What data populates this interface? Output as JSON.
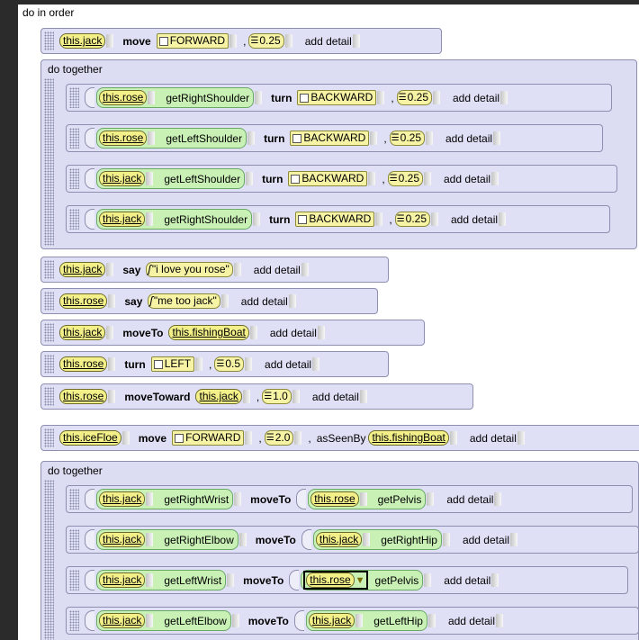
{
  "outer": {
    "label": "do in order"
  },
  "common": {
    "add_detail": "add detail",
    "comma": ","
  },
  "lines": {
    "jack_move": {
      "obj": "this.jack",
      "verb": "move",
      "dir": "FORWARD",
      "amt": "0.25"
    },
    "together1": {
      "label": "do together",
      "rows": [
        {
          "obj": "this.rose",
          "getter": "getRightShoulder",
          "verb": "turn",
          "dir": "BACKWARD",
          "amt": "0.25"
        },
        {
          "obj": "this.rose",
          "getter": "getLeftShoulder",
          "verb": "turn",
          "dir": "BACKWARD",
          "amt": "0.25"
        },
        {
          "obj": "this.jack",
          "getter": "getLeftShoulder",
          "verb": "turn",
          "dir": "BACKWARD",
          "amt": "0.25"
        },
        {
          "obj": "this.jack",
          "getter": "getRightShoulder",
          "verb": "turn",
          "dir": "BACKWARD",
          "amt": "0.25"
        }
      ]
    },
    "jack_say": {
      "obj": "this.jack",
      "verb": "say",
      "text": "\"i love you rose\""
    },
    "rose_say": {
      "obj": "this.rose",
      "verb": "say",
      "text": "\"me too jack\""
    },
    "jack_moveto": {
      "obj": "this.jack",
      "verb": "moveTo",
      "target": "this.fishingBoat"
    },
    "rose_turn": {
      "obj": "this.rose",
      "verb": "turn",
      "dir": "LEFT",
      "amt": "0.5"
    },
    "rose_movetoward": {
      "obj": "this.rose",
      "verb": "moveToward",
      "target": "this.jack",
      "amt": "1.0"
    },
    "icefloe_move": {
      "obj": "this.iceFloe",
      "verb": "move",
      "dir": "FORWARD",
      "amt": "2.0",
      "as_seen_by": "asSeenBy",
      "target": "this.fishingBoat"
    },
    "together2": {
      "label": "do together",
      "rows": [
        {
          "obj": "this.jack",
          "getter": "getRightWrist",
          "verb": "moveTo",
          "tobj": "this.rose",
          "tget": "getPelvis"
        },
        {
          "obj": "this.jack",
          "getter": "getRightElbow",
          "verb": "moveTo",
          "tobj": "this.jack",
          "tget": "getRightHip"
        },
        {
          "obj": "this.jack",
          "getter": "getLeftWrist",
          "verb": "moveTo",
          "tobj": "this.rose",
          "tget": "getPelvis"
        },
        {
          "obj": "this.jack",
          "getter": "getLeftElbow",
          "verb": "moveTo",
          "tobj": "this.jack",
          "tget": "getLeftHip"
        }
      ]
    }
  },
  "icons": {
    "direction": "square-icon",
    "number": "number-icon",
    "string": "string-icon",
    "dropdown": "dropdown-triangle-icon"
  },
  "colors": {
    "object": "#f3f08a",
    "getter": "#c9f1b6",
    "block": "#dfe0f5",
    "editor_bg": "#ffffff",
    "frame": "#2b2b2b"
  }
}
